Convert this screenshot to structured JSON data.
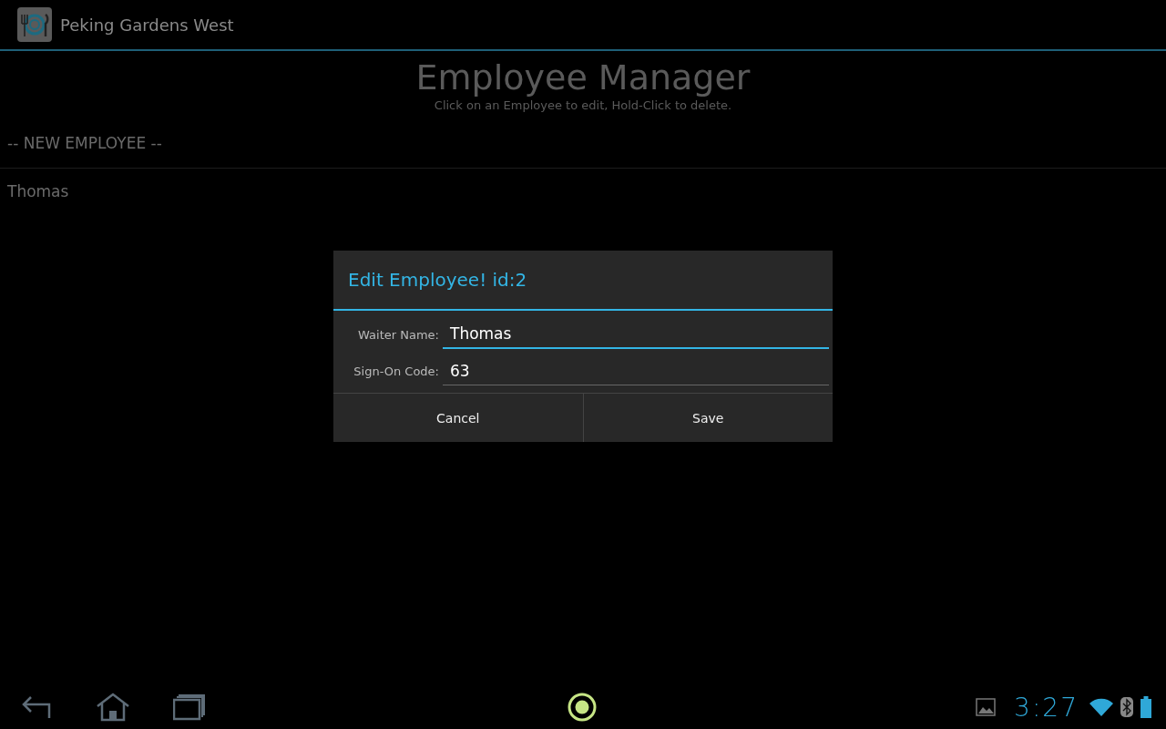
{
  "app_bar": {
    "title": "Peking Gardens West"
  },
  "page": {
    "title": "Employee Manager",
    "subtitle": "Click on an Employee to edit, Hold-Click to delete."
  },
  "employees": [
    {
      "label": "-- NEW EMPLOYEE --"
    },
    {
      "label": "Thomas"
    }
  ],
  "dialog": {
    "title": "Edit Employee! id:2",
    "fields": [
      {
        "label": "Waiter Name:",
        "value": "Thomas",
        "focused": true
      },
      {
        "label": "Sign-On Code:",
        "value": "63",
        "focused": false
      }
    ],
    "buttons": [
      "Cancel",
      "Save"
    ]
  },
  "status_bar": {
    "time": "3:27"
  }
}
